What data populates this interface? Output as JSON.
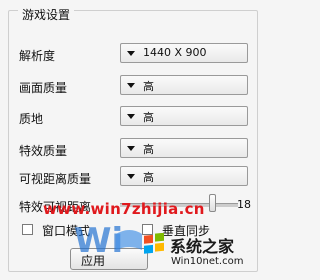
{
  "group_title": "游戏设置",
  "settings": [
    {
      "label": "解析度",
      "value": "1440 X 900"
    },
    {
      "label": "画面质量",
      "value": "高"
    },
    {
      "label": "质地",
      "value": "高"
    },
    {
      "label": "特效质量",
      "value": "高"
    },
    {
      "label": "可视距离质量",
      "value": "高"
    }
  ],
  "view_distance": {
    "label": "特效可视距离",
    "value": "18",
    "level_fraction": 1.0
  },
  "checkboxes": [
    {
      "label": "窗口模式",
      "checked": false
    },
    {
      "label": "垂直同步",
      "checked": false
    }
  ],
  "apply_label": "应用",
  "watermark": {
    "url": "www.win7zhijia.cn",
    "cn_text": "系统之家",
    "site": "Win10net.com",
    "colors": {
      "red": "#e0191d",
      "blue": "#1f6fd1"
    }
  }
}
